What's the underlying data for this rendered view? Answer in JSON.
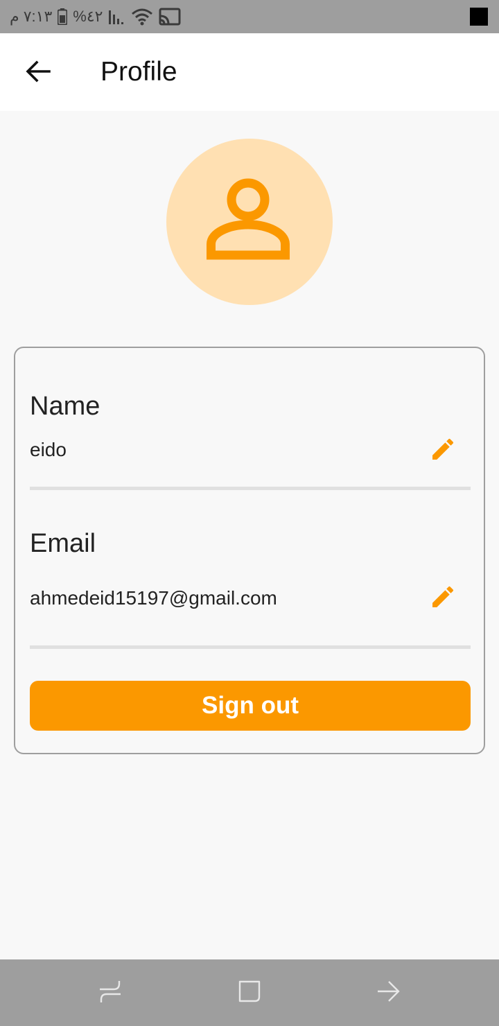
{
  "status_bar": {
    "time": "٧:١٣ م",
    "battery": "%٤٢"
  },
  "app_bar": {
    "title": "Profile"
  },
  "profile": {
    "name_label": "Name",
    "name_value": "eido",
    "email_label": "Email",
    "email_value": "ahmedeid15197@gmail.com",
    "signout_label": "Sign out"
  },
  "icons": {
    "back": "arrow-back-icon",
    "avatar": "person-outline-icon",
    "edit": "pencil-edit-icon",
    "nav_recents": "recents-icon",
    "nav_home": "home-icon",
    "nav_back": "nav-back-icon"
  },
  "colors": {
    "accent": "#fb9800",
    "avatar_bg": "#ffe0b2",
    "status_bar": "#9e9e9e",
    "app_bar": "#ffffff",
    "background": "#f8f8f8",
    "divider": "#e0e0e0"
  }
}
